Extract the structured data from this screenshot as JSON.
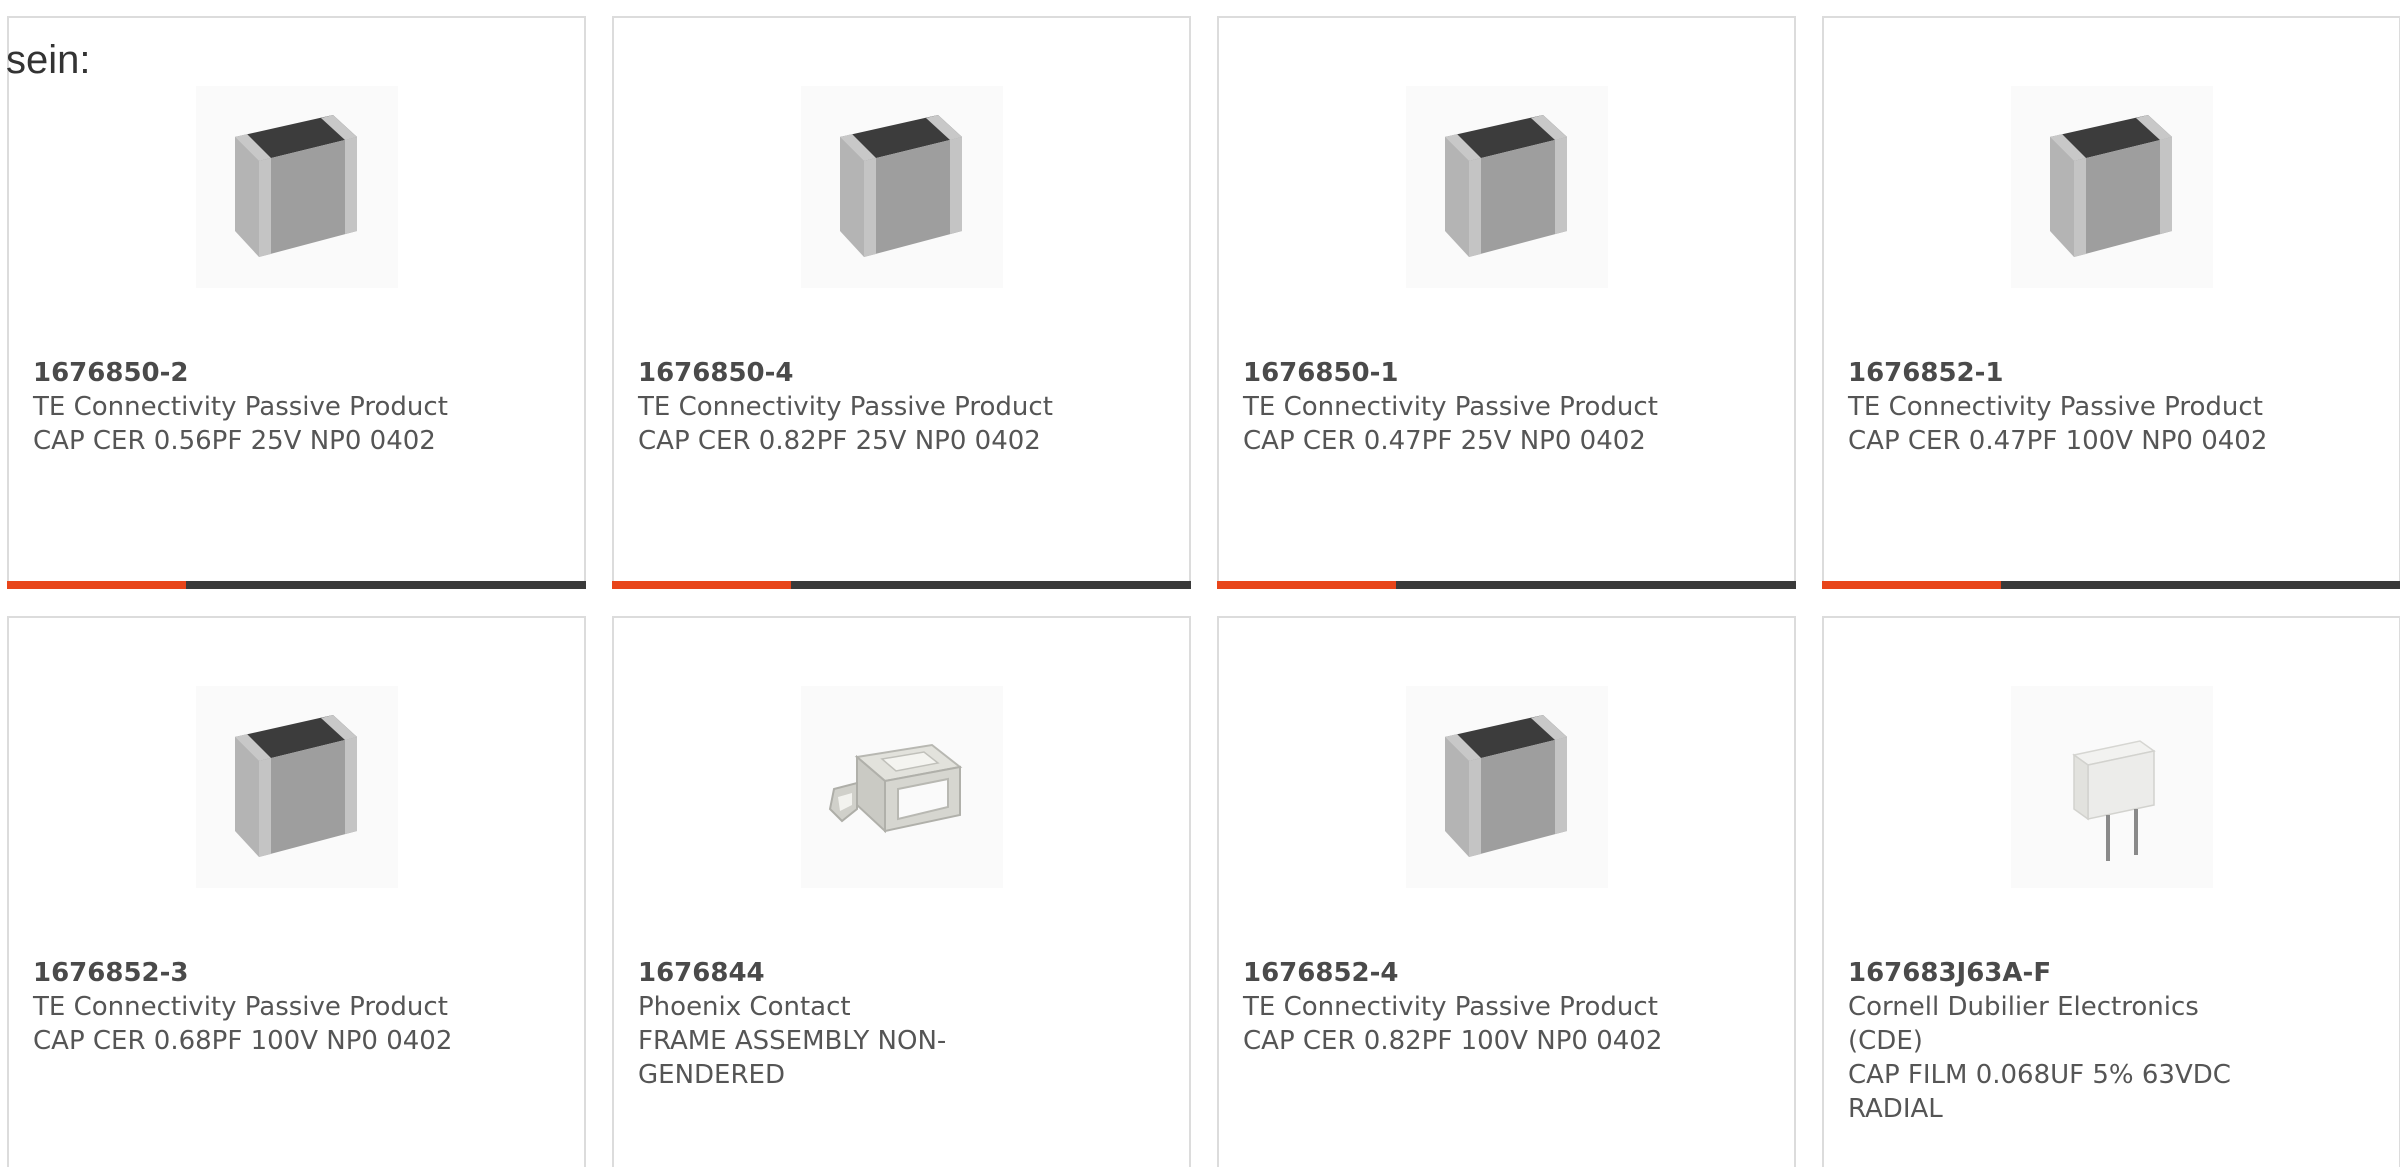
{
  "intro_text": "sein:",
  "colors": {
    "progress_fill": "#e8451a",
    "progress_track": "#3a3a3a",
    "card_border": "#dcdcdc"
  },
  "products": [
    {
      "part_number": "1676850-2",
      "manufacturer": "TE Connectivity Passive Product",
      "description": "CAP CER 0.56PF 25V NP0 0402",
      "image_icon": "chip-capacitor-icon",
      "progress": 0.31
    },
    {
      "part_number": "1676850-4",
      "manufacturer": "TE Connectivity Passive Product",
      "description": "CAP CER 0.82PF 25V NP0 0402",
      "image_icon": "chip-capacitor-icon",
      "progress": 0.31
    },
    {
      "part_number": "1676850-1",
      "manufacturer": "TE Connectivity Passive Product",
      "description": "CAP CER 0.47PF 25V NP0 0402",
      "image_icon": "chip-capacitor-icon",
      "progress": 0.31
    },
    {
      "part_number": "1676852-1",
      "manufacturer": "TE Connectivity Passive Product",
      "description": "CAP CER 0.47PF 100V NP0 0402",
      "image_icon": "chip-capacitor-icon",
      "progress": 0.31
    },
    {
      "part_number": "1676852-3",
      "manufacturer": "TE Connectivity Passive Product",
      "description": "CAP CER 0.68PF 100V NP0 0402",
      "image_icon": "chip-capacitor-icon"
    },
    {
      "part_number": "1676844",
      "manufacturer": "Phoenix Contact",
      "description": "FRAME ASSEMBLY NON-GENDERED",
      "image_icon": "frame-assembly-icon"
    },
    {
      "part_number": "1676852-4",
      "manufacturer": "TE Connectivity Passive Product",
      "description": "CAP CER 0.82PF 100V NP0 0402",
      "image_icon": "chip-capacitor-icon"
    },
    {
      "part_number": "167683J63A-F",
      "manufacturer": "Cornell Dubilier Electronics (CDE)",
      "description": "CAP FILM 0.068UF 5% 63VDC RADIAL",
      "image_icon": "film-capacitor-icon"
    }
  ]
}
